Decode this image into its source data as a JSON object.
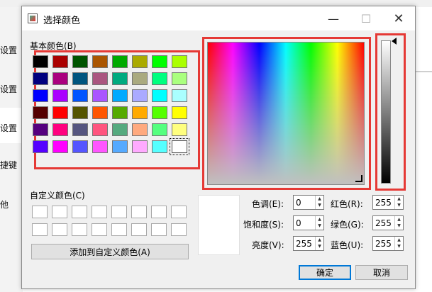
{
  "background_app": {
    "sidebar_items": [
      "设置",
      "设置",
      "设置",
      "捷键",
      "他"
    ]
  },
  "dialog": {
    "title": "选择颜色",
    "window_buttons": {
      "minimize": "—",
      "maximize": "☐",
      "close": "✕"
    },
    "basic_colors_label": "基本颜色(B)",
    "basic_colors": [
      [
        "#000000",
        "#aa0000",
        "#005500",
        "#aa5500",
        "#00aa00",
        "#aaaa00",
        "#00ff00",
        "#aaff00"
      ],
      [
        "#00007f",
        "#aa007f",
        "#00557f",
        "#aa557f",
        "#00aa7f",
        "#aaaa7f",
        "#00ff7f",
        "#aaff7f"
      ],
      [
        "#0000ff",
        "#aa00ff",
        "#0055ff",
        "#aa55ff",
        "#00aaff",
        "#aaaaff",
        "#00ffff",
        "#aaffff"
      ],
      [
        "#550000",
        "#ff0000",
        "#555500",
        "#ff5500",
        "#55aa00",
        "#ffaa00",
        "#55ff00",
        "#ffff00"
      ],
      [
        "#55007f",
        "#ff007f",
        "#55557f",
        "#ff557f",
        "#55aa7f",
        "#ffaa7f",
        "#55ff7f",
        "#ffff7f"
      ],
      [
        "#5500ff",
        "#ff00ff",
        "#5555ff",
        "#ff55ff",
        "#55aaff",
        "#ffaaff",
        "#55ffff",
        "#ffffff"
      ]
    ],
    "selected_basic_color": "#ffffff",
    "custom_colors_label": "自定义颜色(C)",
    "add_custom_button": "添加到自定义颜色(A)",
    "fields": {
      "hue": {
        "label": "色调(E):",
        "value": "0"
      },
      "saturation": {
        "label": "饱和度(S):",
        "value": "0"
      },
      "value": {
        "label": "亮度(V):",
        "value": "255"
      },
      "red": {
        "label": "红色(R):",
        "value": "255"
      },
      "green": {
        "label": "绿色(G):",
        "value": "255"
      },
      "blue": {
        "label": "蓝色(U):",
        "value": "255"
      }
    },
    "ok_button": "确定",
    "cancel_button": "取消"
  }
}
